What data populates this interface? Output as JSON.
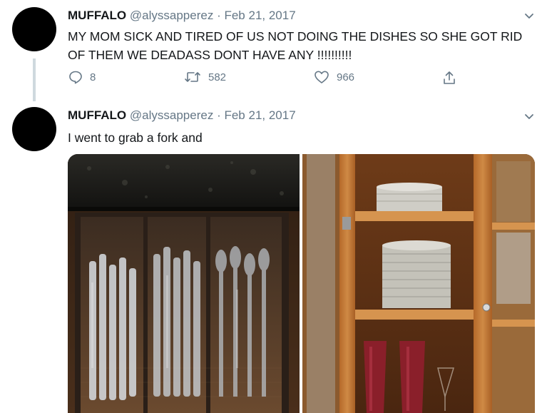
{
  "tweets": [
    {
      "name": "MUFFALO",
      "handle": "@alyssapperez",
      "separator": "·",
      "date": "Feb 21, 2017",
      "text": "MY MOM SICK AND TIRED OF US NOT DOING THE DISHES SO SHE GOT RID OF THEM WE DEADASS DONT HAVE ANY !!!!!!!!!!",
      "replies": "8",
      "retweets": "582",
      "likes": "966"
    },
    {
      "name": "MUFFALO",
      "handle": "@alyssapperez",
      "separator": "·",
      "date": "Feb 21, 2017",
      "text": "I went to grab a fork and",
      "images": [
        "plastic-cutlery-drawer-photo",
        "cabinet-paper-plates-photo"
      ]
    }
  ],
  "colors": {
    "text": "#14171a",
    "secondary": "#657786",
    "thread_line": "#cfd9de",
    "avatar": "#000000"
  }
}
